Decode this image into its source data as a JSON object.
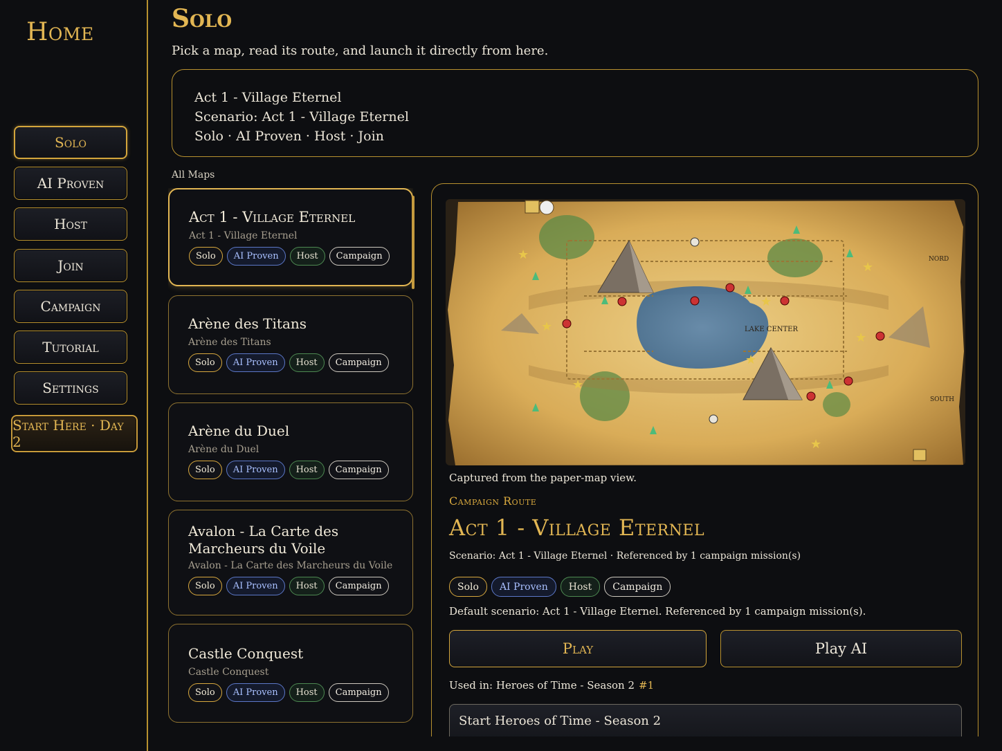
{
  "sidebar": {
    "title": "Home",
    "items": [
      {
        "label": "Solo"
      },
      {
        "label": "AI Proven"
      },
      {
        "label": "Host"
      },
      {
        "label": "Join"
      },
      {
        "label": "Campaign"
      },
      {
        "label": "Tutorial"
      },
      {
        "label": "Settings"
      },
      {
        "label": "Start Here · Day 2"
      }
    ]
  },
  "header": {
    "title": "Solo",
    "subtitle": "Pick a map, read its route, and launch it directly from here."
  },
  "summary": {
    "line1": "Act 1 - Village Eternel",
    "line2": "Scenario: Act 1 - Village Eternel",
    "line3": "Solo · AI Proven · Host · Join"
  },
  "list": {
    "heading": "All Maps",
    "tags": {
      "solo": "Solo",
      "ai": "AI Proven",
      "host": "Host",
      "campaign": "Campaign"
    },
    "maps": [
      {
        "name": "Act 1 - Village Eternel",
        "subname": "Act 1 - Village Eternel"
      },
      {
        "name": "Arène des Titans",
        "subname": "Arène des Titans"
      },
      {
        "name": "Arène du Duel",
        "subname": "Arène du Duel"
      },
      {
        "name": "Avalon - La Carte des Marcheurs du Voile",
        "subname": "Avalon - La Carte des Marcheurs du Voile"
      },
      {
        "name": "Castle Conquest",
        "subname": "Castle Conquest"
      }
    ]
  },
  "detail": {
    "map_labels": {
      "lake": "LAKE CENTER",
      "north": "NORD",
      "south": "SOUTH"
    },
    "caption": "Captured from the paper-map view.",
    "route_label": "Campaign Route",
    "title": "Act 1 - Village Eternel",
    "meta": "Scenario: Act 1 - Village Eternel · Referenced by 1 campaign mission(s)",
    "tags": {
      "solo": "Solo",
      "ai": "AI Proven",
      "host": "Host",
      "campaign": "Campaign"
    },
    "description": "Default scenario: Act 1 - Village Eternel. Referenced by 1 campaign mission(s).",
    "play_label": "Play",
    "play_ai_label": "Play AI",
    "used_in": "Used in: Heroes of Time - Season 2",
    "used_in_number": "#1",
    "start_campaign_label": "Start Heroes of Time - Season 2"
  },
  "colors": {
    "background": "#0d0e11",
    "accent_gold": "#e2b653",
    "border_gold": "#b8912f",
    "tag_ai": "#5c78c9",
    "tag_host": "#4e8a52"
  }
}
